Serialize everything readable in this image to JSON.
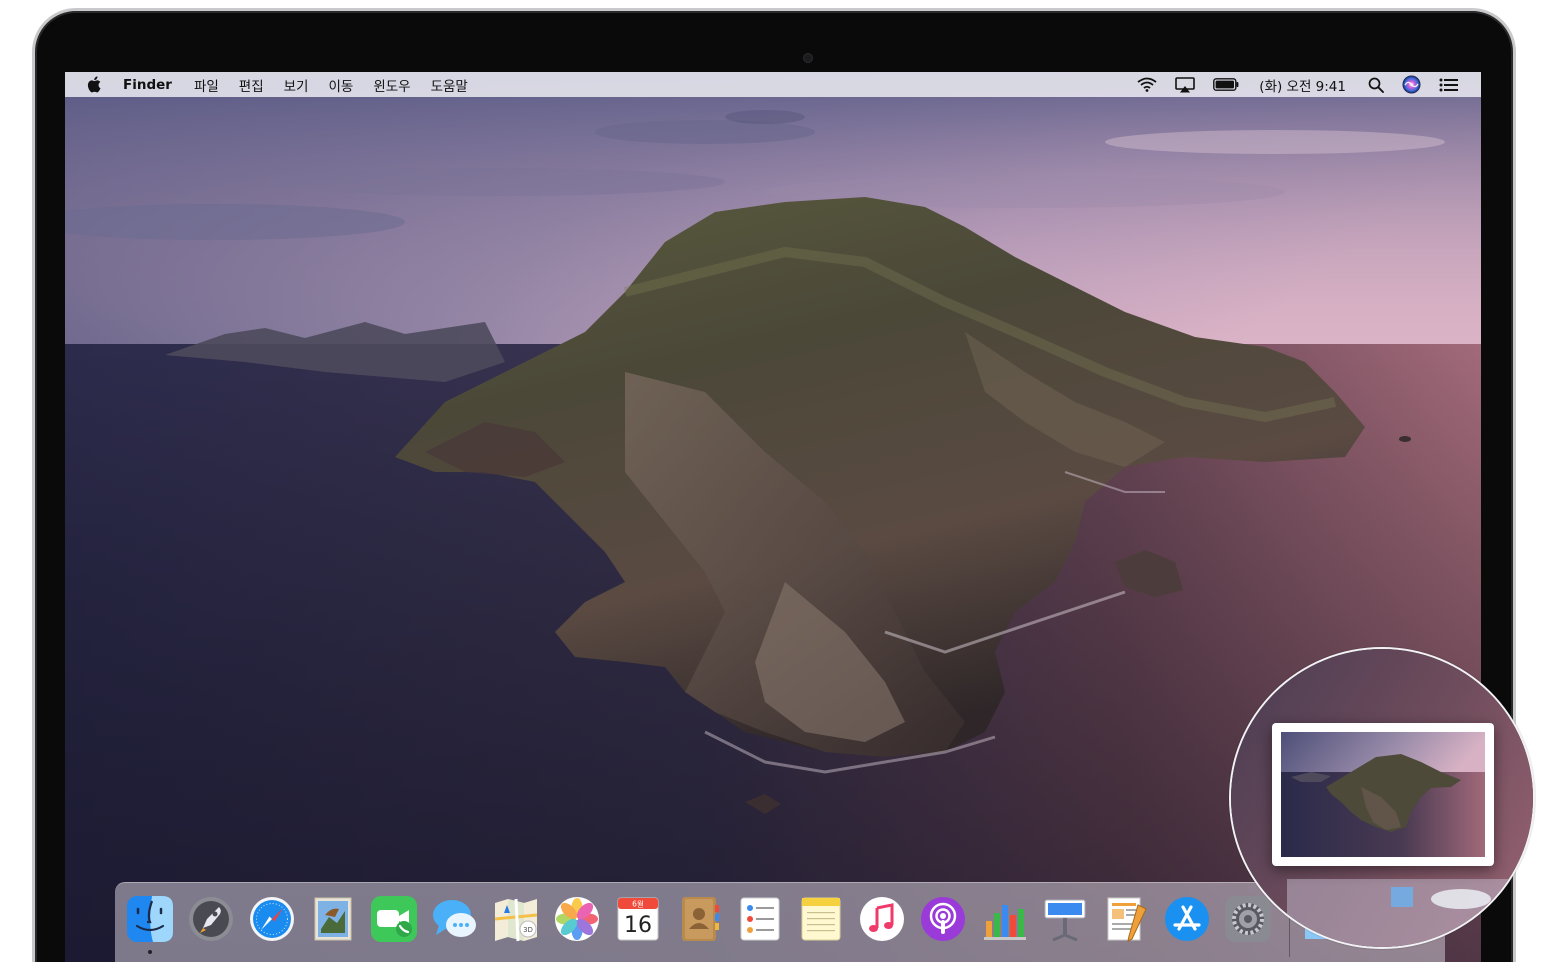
{
  "menubar": {
    "apple_icon": "apple-logo-icon",
    "app_name": "Finder",
    "menus": [
      "파일",
      "편집",
      "보기",
      "이동",
      "윈도우",
      "도움말"
    ],
    "status_icons": [
      "wifi-icon",
      "airplay-icon",
      "battery-icon"
    ],
    "clock": "(화) 오전 9:41",
    "right_icons": [
      "spotlight-icon",
      "siri-icon",
      "notification-center-icon"
    ]
  },
  "dock": {
    "apps": [
      {
        "name": "Finder",
        "icon": "finder-icon",
        "running": true
      },
      {
        "name": "Launchpad",
        "icon": "launchpad-icon",
        "running": false
      },
      {
        "name": "Safari",
        "icon": "safari-icon",
        "running": false
      },
      {
        "name": "Mail",
        "icon": "mail-icon",
        "running": false
      },
      {
        "name": "FaceTime",
        "icon": "facetime-icon",
        "running": false
      },
      {
        "name": "Messages",
        "icon": "messages-icon",
        "running": false
      },
      {
        "name": "Maps",
        "icon": "maps-icon",
        "running": false
      },
      {
        "name": "Photos",
        "icon": "photos-icon",
        "running": false
      },
      {
        "name": "Calendar",
        "icon": "calendar-icon",
        "running": false
      },
      {
        "name": "Contacts",
        "icon": "contacts-icon",
        "running": false
      },
      {
        "name": "Reminders",
        "icon": "reminders-icon",
        "running": false
      },
      {
        "name": "Notes",
        "icon": "notes-icon",
        "running": false
      },
      {
        "name": "Music",
        "icon": "music-icon",
        "running": false
      },
      {
        "name": "Podcasts",
        "icon": "podcasts-icon",
        "running": false
      },
      {
        "name": "Numbers",
        "icon": "numbers-icon",
        "running": false
      },
      {
        "name": "Keynote",
        "icon": "keynote-icon",
        "running": false
      },
      {
        "name": "Pages",
        "icon": "pages-icon",
        "running": false
      },
      {
        "name": "App Store",
        "icon": "app-store-icon",
        "running": false
      },
      {
        "name": "System Preferences",
        "icon": "system-preferences-icon",
        "running": false
      }
    ],
    "calendar": {
      "month": "6월",
      "day": "16"
    },
    "right_items": [
      "downloads-folder-icon",
      "trash-icon"
    ]
  },
  "screenshot_thumbnail": {
    "icon": "screenshot-thumbnail"
  },
  "colors": {
    "menubar_bg": "#e2e2ea",
    "sky_top": "#5e5f86",
    "sea_left": "#2a2a4a",
    "sea_right": "#8a5a6a",
    "dock_bg": "#cdc6d4"
  }
}
